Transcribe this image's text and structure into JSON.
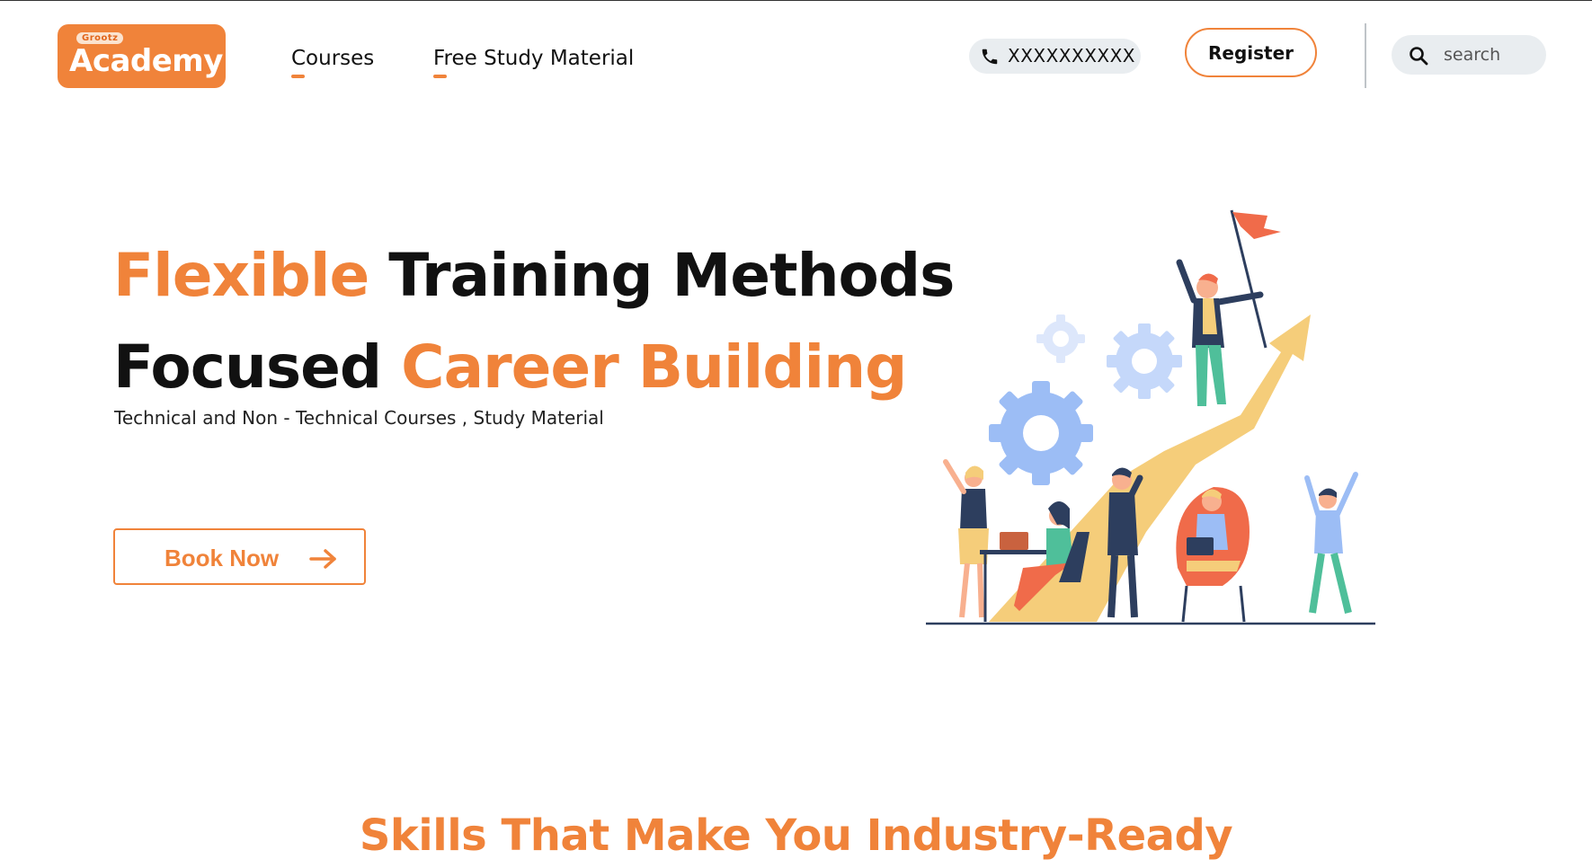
{
  "header": {
    "logo": {
      "small_text": "Grootz",
      "main_text": "Academy",
      "color": "#f0833a"
    },
    "nav": [
      {
        "label": "Courses"
      },
      {
        "label": "Free Study Material"
      }
    ],
    "phone": {
      "icon": "phone-icon",
      "number": "XXXXXXXXXX"
    },
    "register_label": "Register",
    "search": {
      "icon": "search-icon",
      "placeholder": "search"
    }
  },
  "hero": {
    "line1": {
      "orange": "Flexible",
      "black": "Training Methods"
    },
    "line2": {
      "black": "Focused",
      "orange": "Career Building"
    },
    "subtitle": "Technical and Non - Technical Courses , Study Material",
    "cta_label": "Book Now",
    "cta_icon": "arrow-right-icon",
    "illustration": "team-success-illustration"
  },
  "section": {
    "title": "Skills That Make You Industry-Ready"
  },
  "colors": {
    "accent": "#f0833a",
    "text": "#111111",
    "pill_bg": "#e9edf0"
  }
}
